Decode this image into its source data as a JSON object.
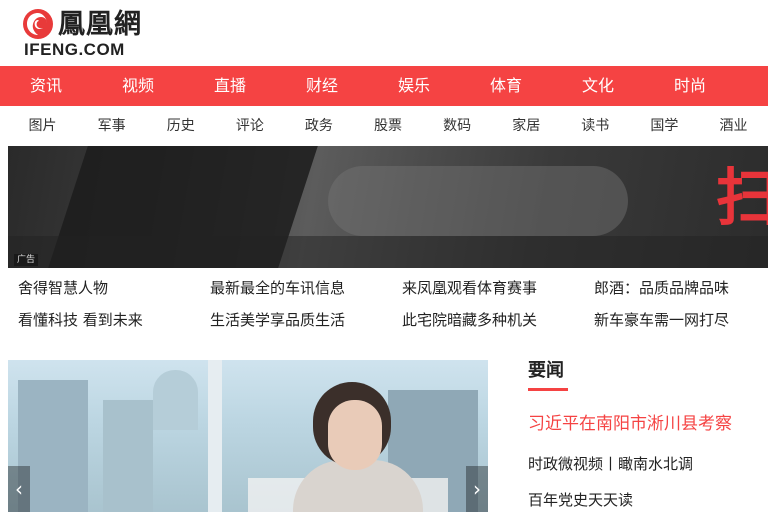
{
  "header": {
    "logo_cn": "鳳凰網",
    "logo_en": "IFENG.COM",
    "brand_color": "#f54343"
  },
  "nav_primary": [
    "资讯",
    "视频",
    "直播",
    "财经",
    "娱乐",
    "体育",
    "文化",
    "时尚"
  ],
  "nav_secondary": [
    "图片",
    "军事",
    "历史",
    "评论",
    "政务",
    "股票",
    "数码",
    "家居",
    "读书",
    "国学",
    "酒业"
  ],
  "banner": {
    "ad_label": "广告",
    "glyph": "扫"
  },
  "promo_links": [
    "舍得智慧人物",
    "最新最全的车讯信息",
    "来凤凰观看体育赛事",
    "郎酒：品质品牌品味",
    "看懂科技 看到未来",
    "生活美学享品质生活",
    "此宅院暗藏多种机关",
    "新车豪车需一网打尽"
  ],
  "slider": {
    "prev_icon": "‹",
    "next_icon": "›"
  },
  "news": {
    "section_title": "要闻",
    "headline": "习近平在南阳市淅川县考察",
    "items": [
      "时政微视频丨瞰南水北调",
      "百年党史天天读"
    ]
  }
}
